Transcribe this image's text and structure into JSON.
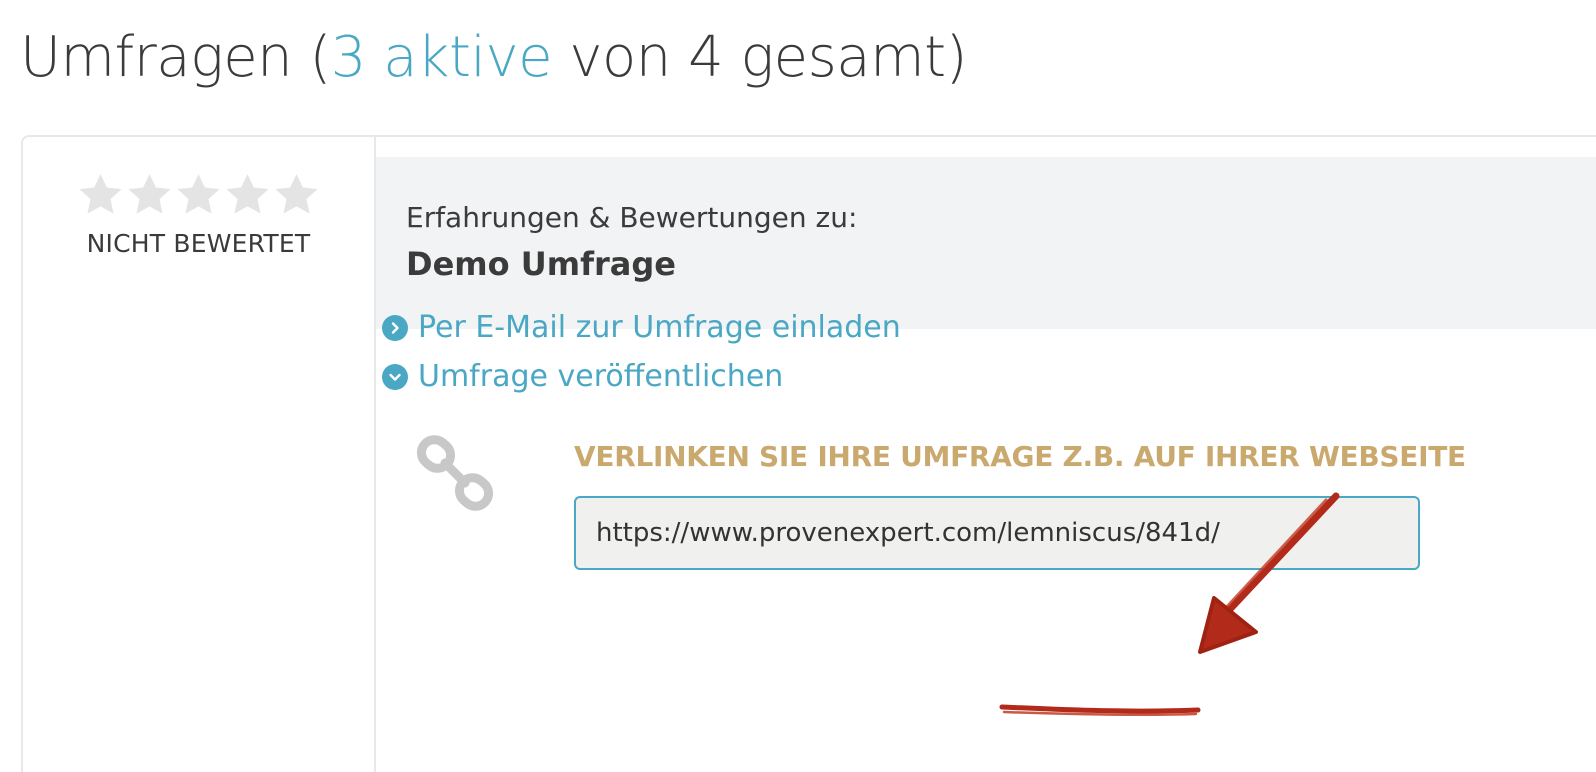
{
  "page": {
    "title_prefix": "Umfragen (",
    "title_active": "3 aktive",
    "title_suffix": " von 4 gesamt)"
  },
  "rating": {
    "stars_filled": 0,
    "stars_total": 5,
    "label": "NICHT BEWERTET"
  },
  "survey": {
    "intro": "Erfahrungen & Bewertungen zu:",
    "name": "Demo Umfrage"
  },
  "actions": {
    "email_invite": "Per E-Mail zur Umfrage einladen",
    "publish": "Umfrage veröffentlichen"
  },
  "embed": {
    "heading": "VERLINKEN SIE IHRE UMFRAGE Z.B. AUF IHRER WEBSEITE",
    "url": "https://www.provenexpert.com/lemniscus/841d/"
  },
  "colors": {
    "accent": "#4aa8c4",
    "heading_gold": "#c9a96e",
    "annotation_red": "#b22a1a",
    "star_empty": "#e4e4e4"
  }
}
